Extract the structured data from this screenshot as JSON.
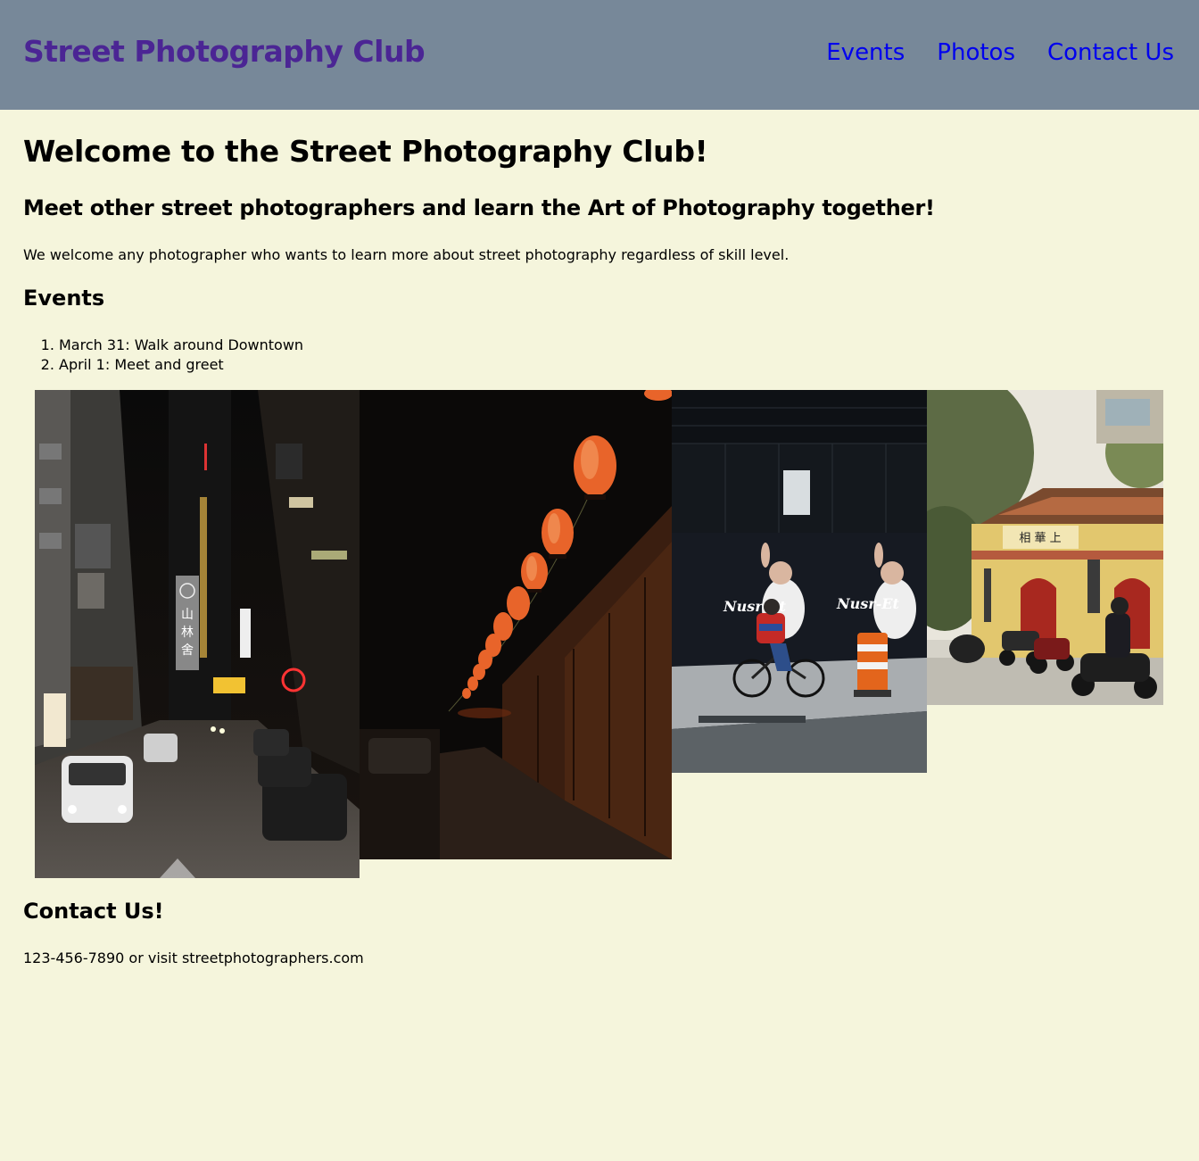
{
  "header": {
    "title": "Street Photography Club",
    "nav": [
      "Events",
      "Photos",
      "Contact Us"
    ]
  },
  "main": {
    "heading": "Welcome to the Street Photography Club!",
    "subheading": "Meet other street photographers and learn the Art of Photography together!",
    "intro": "We welcome any photographer who wants to learn more about street photography regardless of skill level.",
    "events_heading": "Events",
    "events": [
      "March 31: Walk around Downtown",
      "April 1: Meet and greet"
    ],
    "photos": [
      {
        "name": "night-city-street-photo",
        "signs": [
          "山",
          "林",
          "舍"
        ]
      },
      {
        "name": "red-lanterns-alley-photo"
      },
      {
        "name": "cyclist-mural-photo",
        "signs": [
          "Nusr-Et",
          "Nusr-Et"
        ]
      },
      {
        "name": "temple-gate-scooters-photo",
        "signs": [
          "相 華 上"
        ]
      }
    ],
    "contact_heading": "Contact Us!",
    "contact_text": "123-456-7890 or visit streetphotographers.com"
  },
  "colors": {
    "header_bg": "#778899",
    "page_bg": "#f5f5dc",
    "brand": "#4b2594",
    "link": "#0000ee"
  }
}
